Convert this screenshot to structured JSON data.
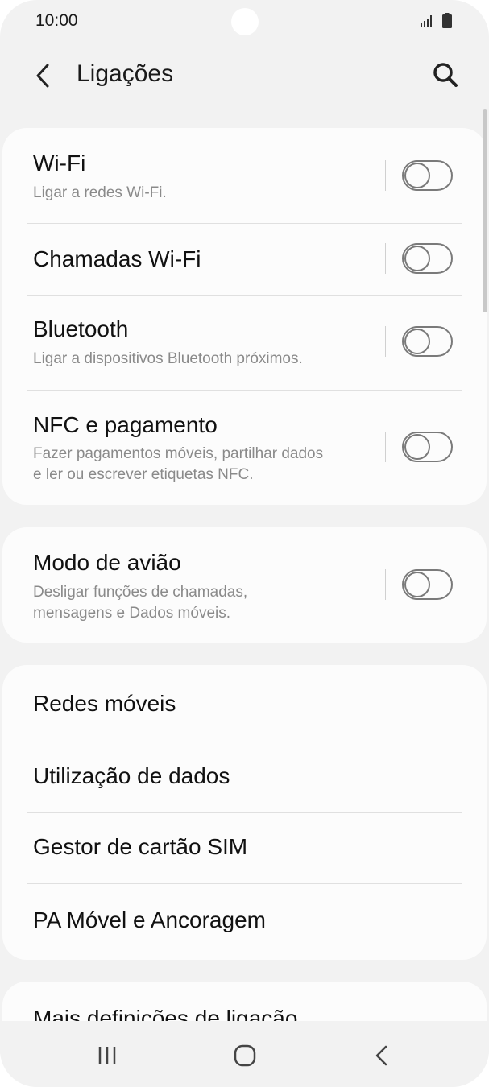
{
  "status_bar": {
    "time": "10:00"
  },
  "header": {
    "title": "Ligações"
  },
  "connections_card": {
    "items": [
      {
        "title": "Wi-Fi",
        "subtitle": "Ligar a redes Wi-Fi.",
        "toggle_on": false
      },
      {
        "title": "Chamadas Wi-Fi",
        "toggle_on": false
      },
      {
        "title": "Bluetooth",
        "subtitle": "Ligar a dispositivos Bluetooth próximos.",
        "toggle_on": false
      },
      {
        "title": "NFC e pagamento",
        "subtitle_line1": "Fazer pagamentos móveis, partilhar dados",
        "subtitle_line2": "e ler ou escrever etiquetas NFC.",
        "toggle_on": false
      }
    ]
  },
  "airplane_card": {
    "title": "Modo de avião",
    "subtitle_line1": "Desligar funções de chamadas,",
    "subtitle_line2": "mensagens e Dados móveis.",
    "toggle_on": false
  },
  "network_card": {
    "items": [
      {
        "title": "Redes móveis"
      },
      {
        "title": "Utilização de dados"
      },
      {
        "title": "Gestor de cartão SIM"
      },
      {
        "title": "PA Móvel e Ancoragem"
      }
    ]
  },
  "more_card": {
    "title": "Mais definições de ligação"
  },
  "colors": {
    "background": "#f2f2f2",
    "card": "#fcfcfc",
    "subtitle": "#8a8a8a",
    "toggle_outline": "#7a7a7a"
  },
  "icons": [
    "signal-icon",
    "battery-icon",
    "back-arrow-icon",
    "search-icon",
    "recent-apps-icon",
    "home-icon",
    "nav-back-icon"
  ]
}
